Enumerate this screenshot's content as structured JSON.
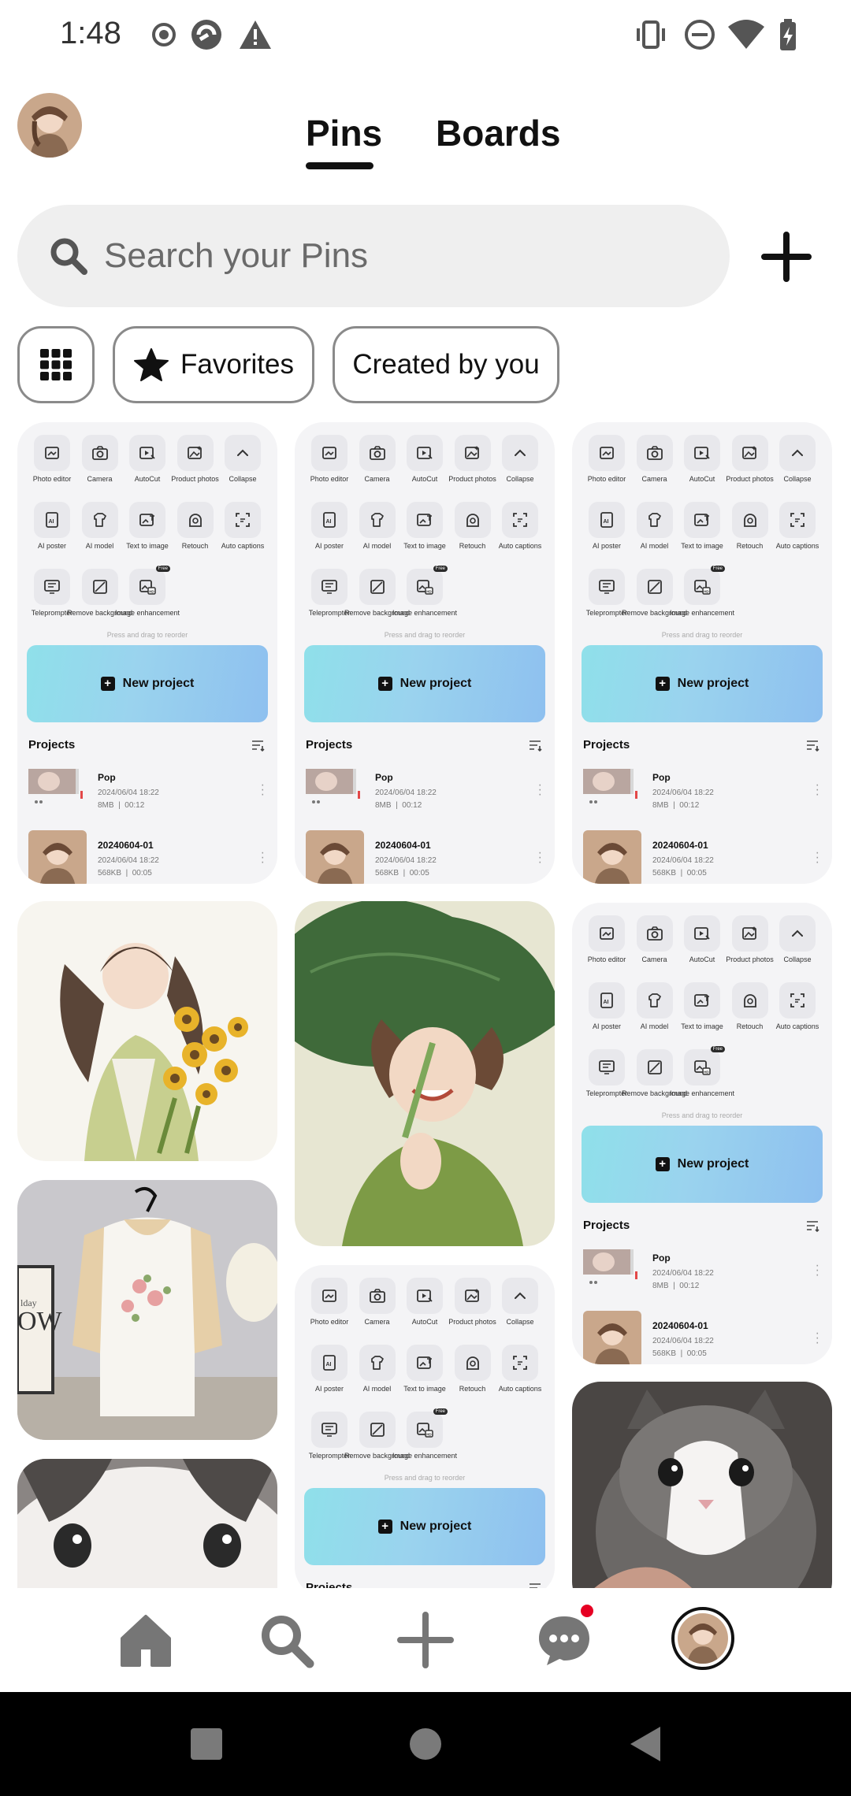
{
  "status_bar": {
    "time": "1:48"
  },
  "header": {
    "tabs": [
      "Pins",
      "Boards"
    ],
    "active_tab": "Pins"
  },
  "search": {
    "placeholder": "Search your Pins"
  },
  "filters": {
    "favorites": "Favorites",
    "created": "Created by you"
  },
  "editor_card": {
    "tools": [
      {
        "label": "Photo editor",
        "icon": "photo-editor-icon"
      },
      {
        "label": "Camera",
        "icon": "camera-icon"
      },
      {
        "label": "AutoCut",
        "icon": "autocut-icon"
      },
      {
        "label": "Product photos",
        "icon": "product-photos-icon"
      },
      {
        "label": "Collapse",
        "icon": "chevron-up-icon"
      },
      {
        "label": "AI poster",
        "icon": "ai-poster-icon"
      },
      {
        "label": "AI model",
        "icon": "ai-model-icon"
      },
      {
        "label": "Text to image",
        "icon": "text-to-image-icon"
      },
      {
        "label": "Retouch",
        "icon": "retouch-icon"
      },
      {
        "label": "Auto captions",
        "icon": "auto-captions-icon"
      },
      {
        "label": "Teleprompter",
        "icon": "teleprompter-icon"
      },
      {
        "label": "Remove background",
        "icon": "remove-background-icon"
      },
      {
        "label": "Image enhancement",
        "icon": "image-enhancement-icon"
      }
    ],
    "free_badge": "Free",
    "hint": "Press and drag to reorder",
    "new_project": "New project",
    "projects_title": "Projects",
    "projects": [
      {
        "name": "Pop",
        "date": "2024/06/04 18:22",
        "size": "8MB",
        "duration": "00:12"
      },
      {
        "name": "20240604-01",
        "date": "2024/06/04 18:22",
        "size": "568KB",
        "duration": "00:05"
      }
    ]
  },
  "colors": {
    "accent": "#111111",
    "notification": "#e60023"
  }
}
